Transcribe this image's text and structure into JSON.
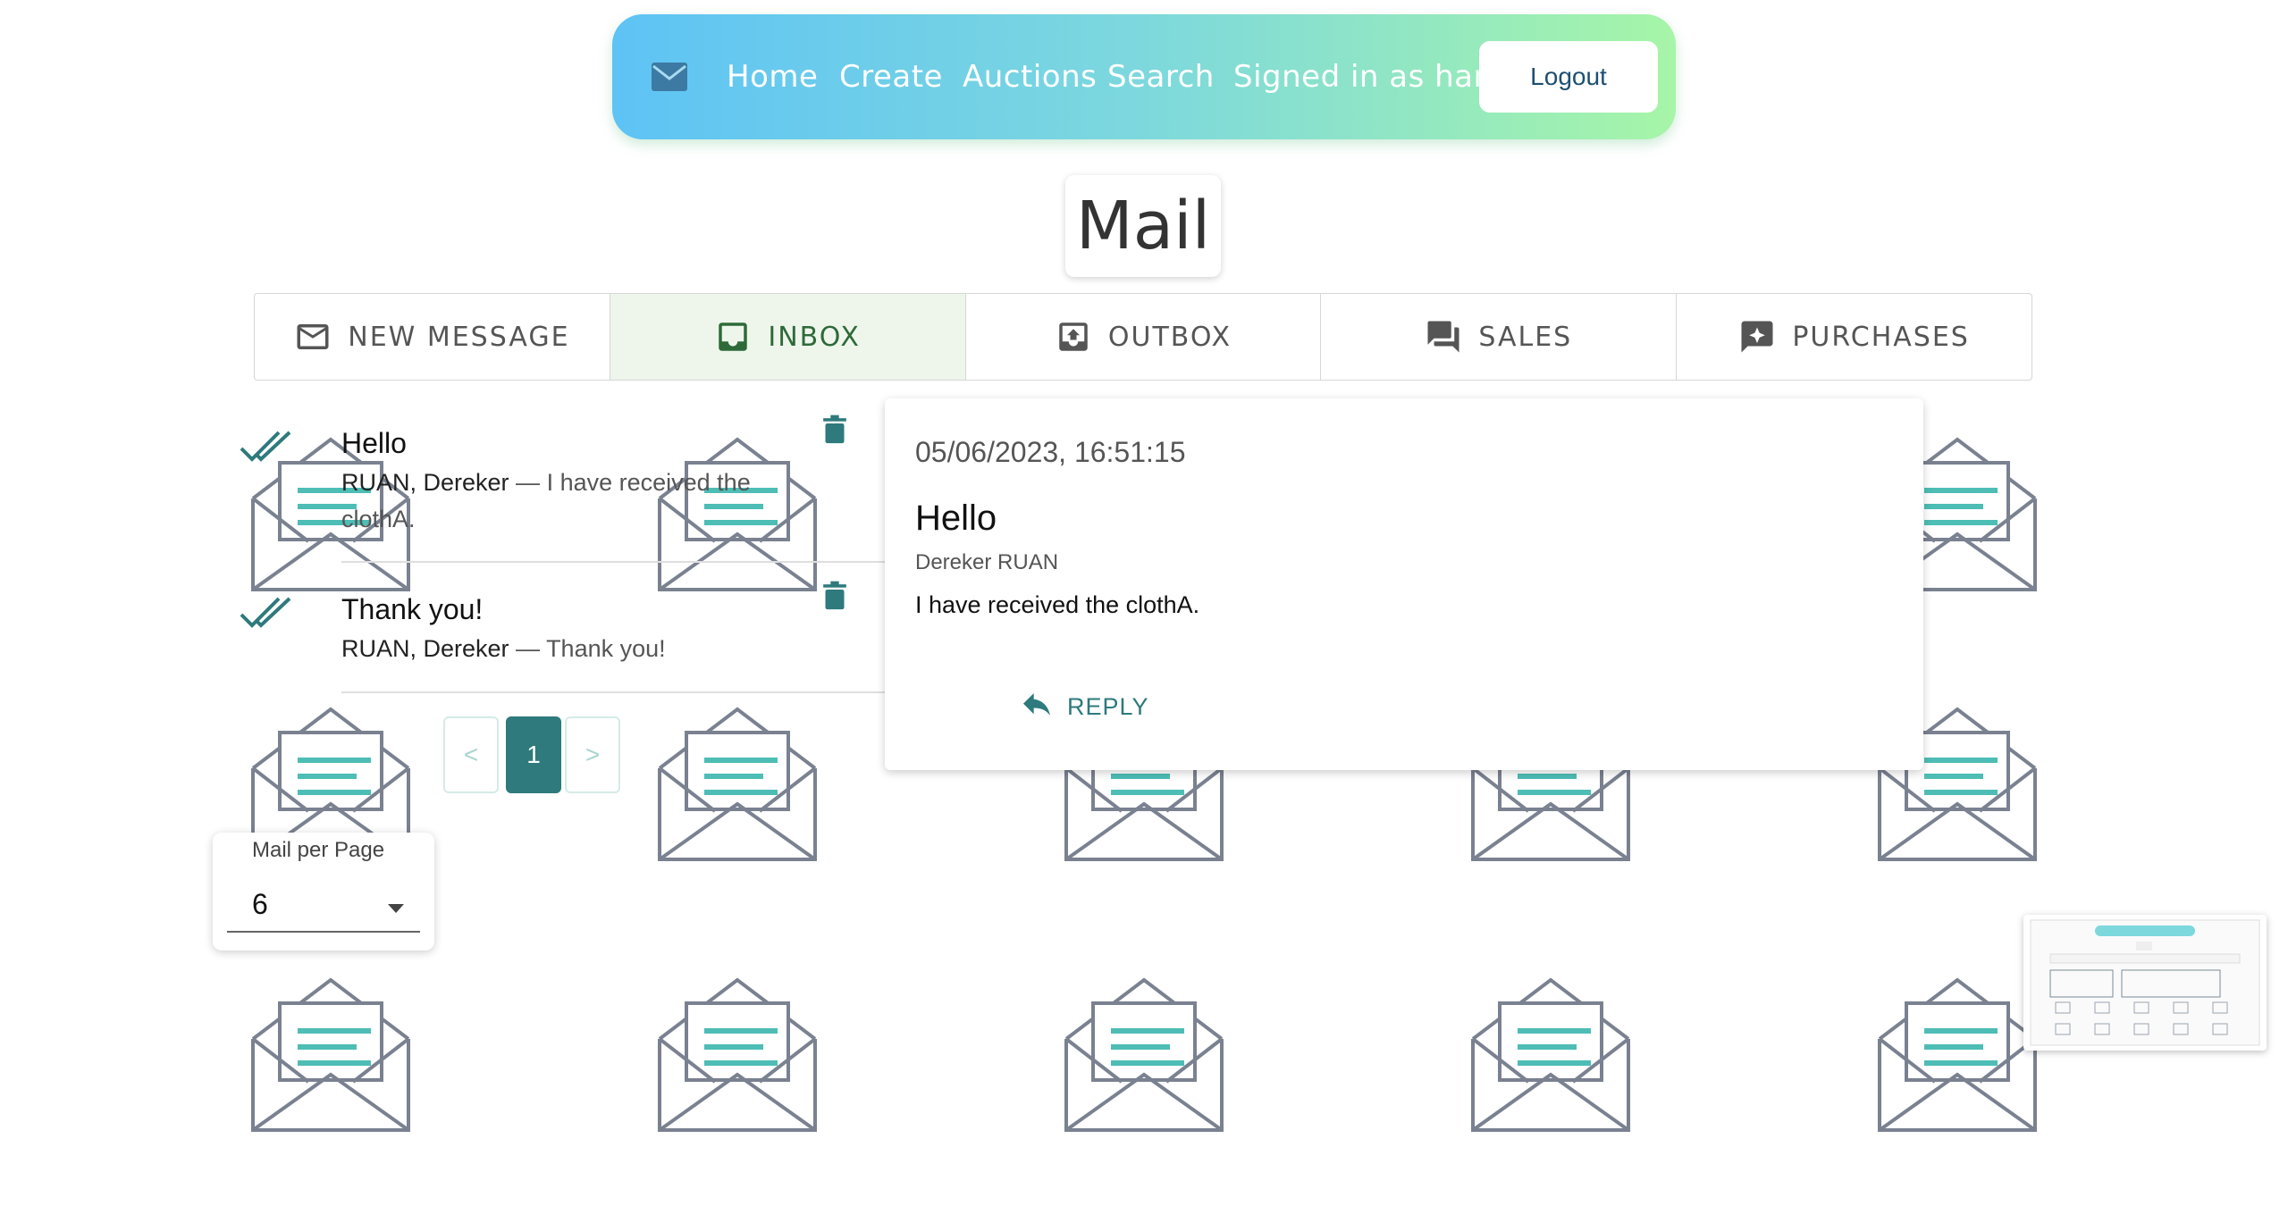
{
  "nav": {
    "links": [
      "Home",
      "Create",
      "Auctions",
      "Search"
    ],
    "signed_in": "Signed in as hans",
    "logout": "Logout"
  },
  "page_title": "Mail",
  "tabs": [
    {
      "label": "NEW MESSAGE",
      "icon": "mail-outline-icon"
    },
    {
      "label": "INBOX",
      "icon": "inbox-icon",
      "active": true
    },
    {
      "label": "OUTBOX",
      "icon": "outbox-icon"
    },
    {
      "label": "SALES",
      "icon": "forum-icon"
    },
    {
      "label": "PURCHASES",
      "icon": "chat-star-icon"
    }
  ],
  "mails": [
    {
      "subject": "Hello",
      "sender": "RUAN, Dereker",
      "separator": " — ",
      "snippet": "I have received the clothA.",
      "status": "read"
    },
    {
      "subject": "Thank you!",
      "sender": "RUAN, Dereker",
      "separator": " — ",
      "snippet": "Thank you!",
      "status": "read"
    }
  ],
  "pagination": {
    "prev": "<",
    "current": "1",
    "next": ">"
  },
  "per_page": {
    "label": "Mail per Page",
    "value": "6"
  },
  "detail": {
    "date": "05/06/2023, 16:51:15",
    "subject": "Hello",
    "from": "Dereker RUAN",
    "body": "I have received the clothA.",
    "reply": "REPLY"
  },
  "colors": {
    "accent": "#2e7a7c",
    "inbox_active": "#2e6a39",
    "envelope_lines": "#4dbdb5"
  }
}
